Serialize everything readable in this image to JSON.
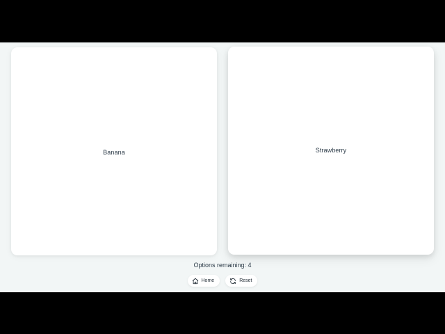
{
  "options": {
    "left_label": "Banana",
    "right_label": "Strawberry"
  },
  "status": {
    "remaining_text": "Options remaining: 4"
  },
  "controls": {
    "home_label": "Home",
    "reset_label": "Reset"
  },
  "icons": {
    "home": "home-icon",
    "reset": "refresh-icon"
  },
  "colors": {
    "background": "#f2f6f6",
    "card": "#ffffff",
    "text": "#2b3a47"
  }
}
